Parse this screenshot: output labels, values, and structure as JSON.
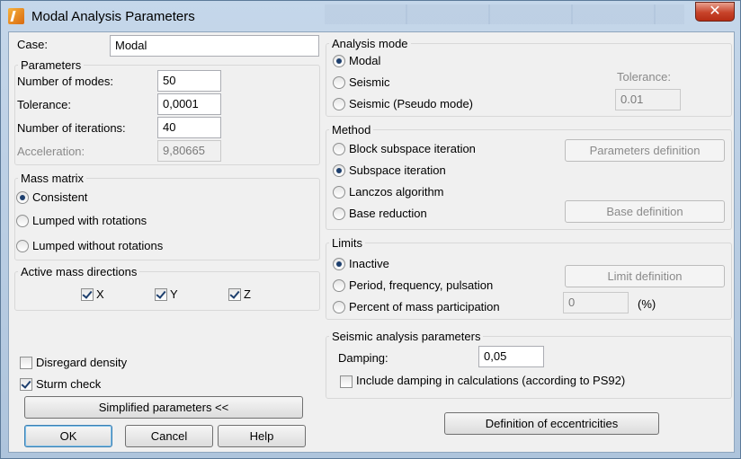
{
  "window": {
    "title": "Modal Analysis Parameters",
    "close_symbol": "✕"
  },
  "case": {
    "label": "Case:",
    "value": "Modal"
  },
  "parameters": {
    "title": "Parameters",
    "modes_label": "Number of modes:",
    "modes_value": "50",
    "tolerance_label": "Tolerance:",
    "tolerance_value": "0,0001",
    "iterations_label": "Number of iterations:",
    "iterations_value": "40",
    "acceleration_label": "Acceleration:",
    "acceleration_value": "9,80665"
  },
  "mass_matrix": {
    "title": "Mass matrix",
    "options": [
      "Consistent",
      "Lumped with rotations",
      "Lumped without rotations"
    ],
    "selected": 0
  },
  "active_mass": {
    "title": "Active mass directions",
    "directions": [
      "X",
      "Y",
      "Z"
    ]
  },
  "options": {
    "disregard_density": "Disregard density",
    "sturm_check": "Sturm check"
  },
  "buttons": {
    "simplified": "Simplified parameters <<",
    "ok": "OK",
    "cancel": "Cancel",
    "help": "Help",
    "parameters_definition": "Parameters definition",
    "base_definition": "Base definition",
    "limit_definition": "Limit definition",
    "eccentricities": "Definition of eccentricities"
  },
  "analysis_mode": {
    "title": "Analysis mode",
    "options": [
      "Modal",
      "Seismic",
      "Seismic (Pseudo mode)"
    ],
    "selected": 0,
    "tolerance_label": "Tolerance:",
    "tolerance_value": "0.01"
  },
  "method": {
    "title": "Method",
    "options": [
      "Block subspace iteration",
      "Subspace iteration",
      "Lanczos algorithm",
      "Base reduction"
    ],
    "selected": 1
  },
  "limits": {
    "title": "Limits",
    "options": [
      "Inactive",
      "Period, frequency, pulsation",
      "Percent of mass participation"
    ],
    "selected": 0,
    "percent_value": "0",
    "percent_unit": "(%)"
  },
  "seismic": {
    "title": "Seismic analysis parameters",
    "damping_label": "Damping:",
    "damping_value": "0,05",
    "include_damping": "Include damping in calculations (according to PS92)"
  }
}
